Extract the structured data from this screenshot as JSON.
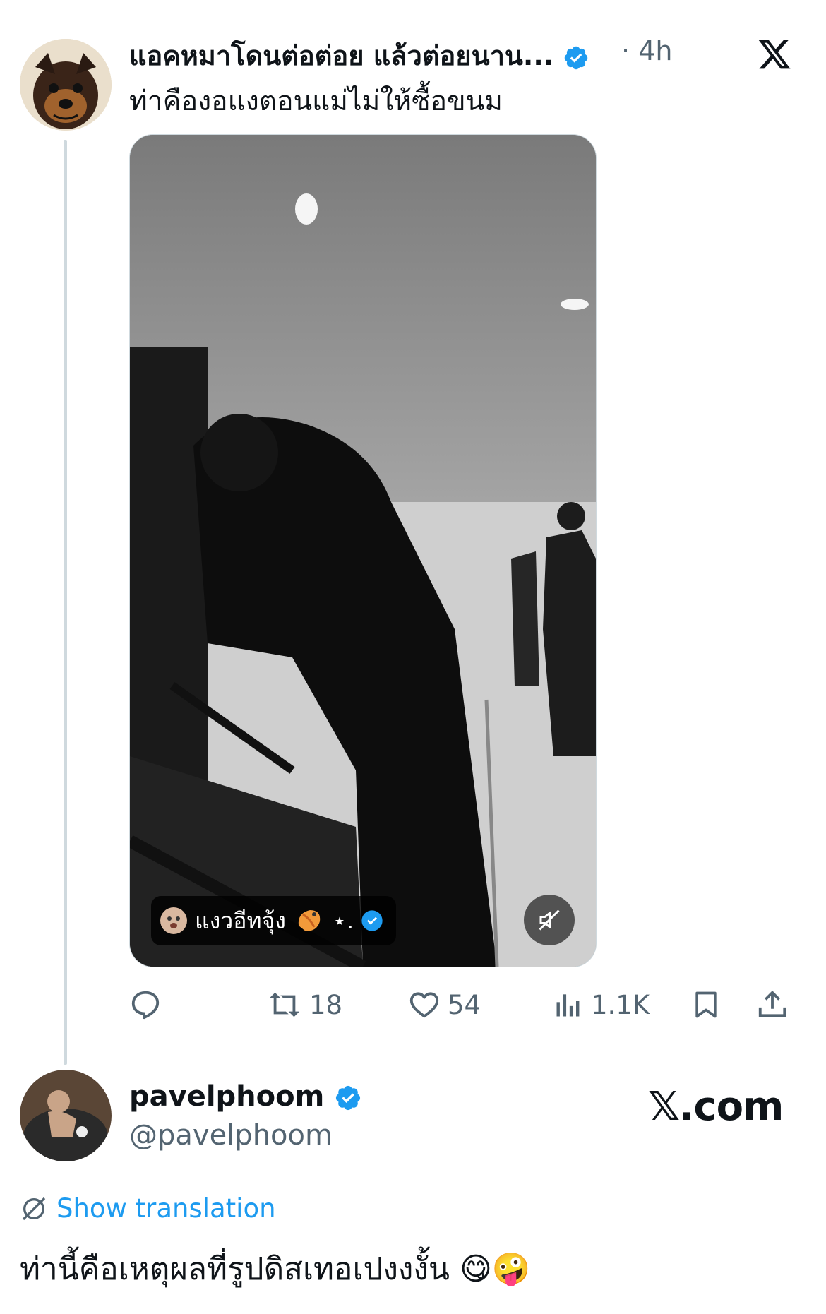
{
  "quoted_tweet": {
    "display_name": "แอคหมาโดนต่อต่อย แล้วต่อยนาน...",
    "verified": true,
    "time_ago": "· 4h",
    "text": "ท่าคืองอแงตอนแม่ไม่ให้ซื้อขนม",
    "avatar": "dog-avatar",
    "video": {
      "overlay_label": "แงวอีทจุ้ง",
      "overlay_suffix": "⋆.",
      "mute_icon": "muted-speaker-icon"
    },
    "actions": {
      "reply_count": "",
      "retweet_count": "18",
      "like_count": "54",
      "view_count": "1.1K"
    }
  },
  "reply": {
    "display_name": "pavelphoom",
    "handle": "@pavelphoom",
    "verified": true,
    "avatar": "person-in-bath-avatar",
    "show_translation": "Show translation",
    "text": "ท่านี้คือเหตุผลที่รูปดิสเทอเปงงงั้น 😋🤪"
  },
  "brand": {
    "watermark": "𝕏.com",
    "logo": "x-logo-icon"
  },
  "colors": {
    "accent": "#1d9bf0",
    "text": "#0f1419",
    "muted": "#536471",
    "line": "#cfd9de"
  }
}
